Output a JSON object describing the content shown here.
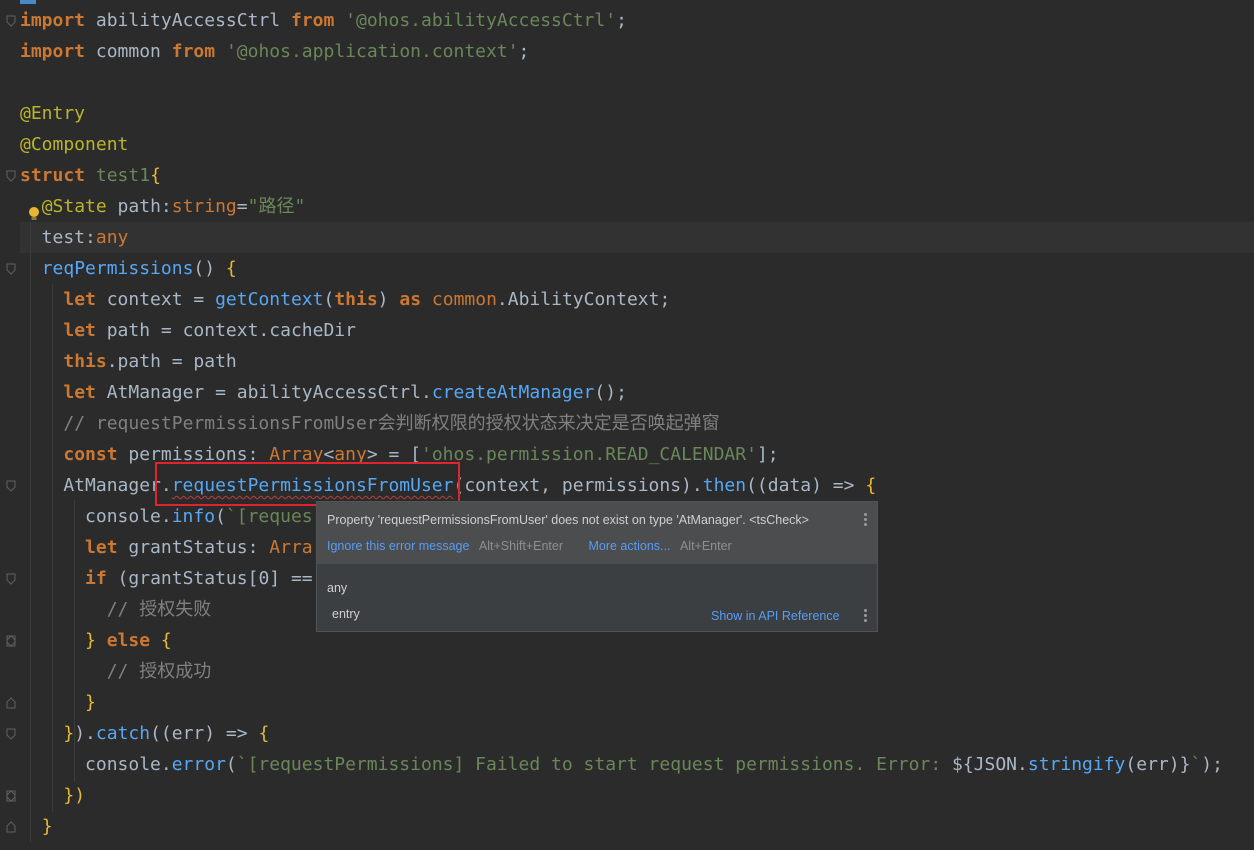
{
  "editor": {
    "lines": [
      [
        {
          "c": "kw",
          "t": "import"
        },
        {
          "c": "plain",
          "t": " abilityAccessCtrl "
        },
        {
          "c": "kw",
          "t": "from"
        },
        {
          "c": "plain",
          "t": " "
        },
        {
          "c": "str",
          "t": "'@ohos.abilityAccessCtrl'"
        },
        {
          "c": "plain",
          "t": ";"
        }
      ],
      [
        {
          "c": "kw",
          "t": "import"
        },
        {
          "c": "plain",
          "t": " common "
        },
        {
          "c": "kw",
          "t": "from"
        },
        {
          "c": "plain",
          "t": " "
        },
        {
          "c": "str",
          "t": "'@ohos.application.context'"
        },
        {
          "c": "plain",
          "t": ";"
        }
      ],
      [],
      [
        {
          "c": "ann",
          "t": "@Entry"
        }
      ],
      [
        {
          "c": "ann",
          "t": "@Component"
        }
      ],
      [
        {
          "c": "kw",
          "t": "struct"
        },
        {
          "c": "plain",
          "t": " "
        },
        {
          "c": "cls",
          "t": "test1"
        },
        {
          "c": "brk",
          "t": "{"
        }
      ],
      [
        {
          "c": "plain",
          "t": "  "
        },
        {
          "c": "ann",
          "t": "@State"
        },
        {
          "c": "plain",
          "t": " path:"
        },
        {
          "c": "typ",
          "t": "string"
        },
        {
          "c": "plain",
          "t": "="
        },
        {
          "c": "str",
          "t": "\"路径\""
        }
      ],
      [
        {
          "c": "plain",
          "t": "  test:"
        },
        {
          "c": "typ",
          "t": "any"
        }
      ],
      [
        {
          "c": "plain",
          "t": "  "
        },
        {
          "c": "fn",
          "t": "reqPermissions"
        },
        {
          "c": "plain",
          "t": "() "
        },
        {
          "c": "brk",
          "t": "{"
        }
      ],
      [
        {
          "c": "plain",
          "t": "    "
        },
        {
          "c": "kw",
          "t": "let"
        },
        {
          "c": "plain",
          "t": " context = "
        },
        {
          "c": "fn",
          "t": "getContext"
        },
        {
          "c": "plain",
          "t": "("
        },
        {
          "c": "kw",
          "t": "this"
        },
        {
          "c": "plain",
          "t": ") "
        },
        {
          "c": "kw",
          "t": "as"
        },
        {
          "c": "plain",
          "t": " "
        },
        {
          "c": "typ",
          "t": "common"
        },
        {
          "c": "plain",
          "t": ".AbilityContext;"
        }
      ],
      [
        {
          "c": "plain",
          "t": "    "
        },
        {
          "c": "kw",
          "t": "let"
        },
        {
          "c": "plain",
          "t": " path = context.cacheDir"
        }
      ],
      [
        {
          "c": "plain",
          "t": "    "
        },
        {
          "c": "kw",
          "t": "this"
        },
        {
          "c": "plain",
          "t": ".path = path"
        }
      ],
      [
        {
          "c": "plain",
          "t": "    "
        },
        {
          "c": "kw",
          "t": "let"
        },
        {
          "c": "plain",
          "t": " AtManager = abilityAccessCtrl."
        },
        {
          "c": "fn",
          "t": "createAtManager"
        },
        {
          "c": "plain",
          "t": "();"
        }
      ],
      [
        {
          "c": "plain",
          "t": "    "
        },
        {
          "c": "cmt",
          "t": "// requestPermissionsFromUser会判断权限的授权状态来决定是否唤起弹窗"
        }
      ],
      [
        {
          "c": "plain",
          "t": "    "
        },
        {
          "c": "kw",
          "t": "const"
        },
        {
          "c": "plain",
          "t": " permissions: "
        },
        {
          "c": "typ",
          "t": "Array"
        },
        {
          "c": "plain",
          "t": "<"
        },
        {
          "c": "typ",
          "t": "any"
        },
        {
          "c": "plain",
          "t": "> = ["
        },
        {
          "c": "str",
          "t": "'ohos.permission.READ_CALENDAR'"
        },
        {
          "c": "plain",
          "t": "];"
        }
      ],
      [
        {
          "c": "plain",
          "t": "    AtManager."
        },
        {
          "c": "fn err",
          "t": "requestPermissionsFromUser"
        },
        {
          "c": "plain",
          "t": "(context, permissions)."
        },
        {
          "c": "fn",
          "t": "then"
        },
        {
          "c": "plain",
          "t": "((data) => "
        },
        {
          "c": "brk",
          "t": "{"
        }
      ],
      [
        {
          "c": "plain",
          "t": "      console."
        },
        {
          "c": "fn",
          "t": "info"
        },
        {
          "c": "plain",
          "t": "("
        },
        {
          "c": "str",
          "t": "`[reques"
        }
      ],
      [
        {
          "c": "plain",
          "t": "      "
        },
        {
          "c": "kw",
          "t": "let"
        },
        {
          "c": "plain",
          "t": " grantStatus: "
        },
        {
          "c": "typ",
          "t": "Arra"
        }
      ],
      [
        {
          "c": "plain",
          "t": "      "
        },
        {
          "c": "kw",
          "t": "if"
        },
        {
          "c": "plain",
          "t": " (grantStatus["
        },
        {
          "c": "plain",
          "t": "0"
        },
        {
          "c": "plain",
          "t": "] =="
        }
      ],
      [
        {
          "c": "plain",
          "t": "        "
        },
        {
          "c": "cmt",
          "t": "// 授权失败"
        }
      ],
      [
        {
          "c": "plain",
          "t": "      "
        },
        {
          "c": "brk",
          "t": "}"
        },
        {
          "c": "plain",
          "t": " "
        },
        {
          "c": "kw",
          "t": "else"
        },
        {
          "c": "plain",
          "t": " "
        },
        {
          "c": "brk",
          "t": "{"
        }
      ],
      [
        {
          "c": "plain",
          "t": "        "
        },
        {
          "c": "cmt",
          "t": "// 授权成功"
        }
      ],
      [
        {
          "c": "plain",
          "t": "      "
        },
        {
          "c": "brk",
          "t": "}"
        }
      ],
      [
        {
          "c": "plain",
          "t": "    "
        },
        {
          "c": "brk",
          "t": "}"
        },
        {
          "c": "plain",
          "t": ")."
        },
        {
          "c": "fn",
          "t": "catch"
        },
        {
          "c": "plain",
          "t": "((err) => "
        },
        {
          "c": "brk",
          "t": "{"
        }
      ],
      [
        {
          "c": "plain",
          "t": "      console."
        },
        {
          "c": "fn",
          "t": "error"
        },
        {
          "c": "plain",
          "t": "("
        },
        {
          "c": "str",
          "t": "`[requestPermissions] Failed to start request permissions. Error: "
        },
        {
          "c": "plain",
          "t": "${JSON."
        },
        {
          "c": "fn",
          "t": "stringify"
        },
        {
          "c": "plain",
          "t": "(err)}"
        },
        {
          "c": "str",
          "t": "`"
        },
        {
          "c": "plain",
          "t": ");"
        }
      ],
      [
        {
          "c": "plain",
          "t": "    "
        },
        {
          "c": "brk",
          "t": "})"
        }
      ],
      [
        {
          "c": "plain",
          "t": "  "
        },
        {
          "c": "brk",
          "t": "}"
        }
      ]
    ]
  },
  "popup": {
    "error_message": "Property 'requestPermissionsFromUser' does not exist on type 'AtManager'. <tsCheck>",
    "ignore_action": "Ignore this error message",
    "ignore_shortcut": "Alt+Shift+Enter",
    "more_action": "More actions...",
    "more_shortcut": "Alt+Enter",
    "doc_type": "any",
    "doc_entry": "entry",
    "api_link": "Show in API Reference"
  },
  "colors": {
    "background": "#2b2b2b",
    "keyword": "#cc7832",
    "string": "#6a8759",
    "function": "#56a8f5",
    "comment": "#808080",
    "highlight_box": "#e0232d",
    "link": "#589df6"
  }
}
